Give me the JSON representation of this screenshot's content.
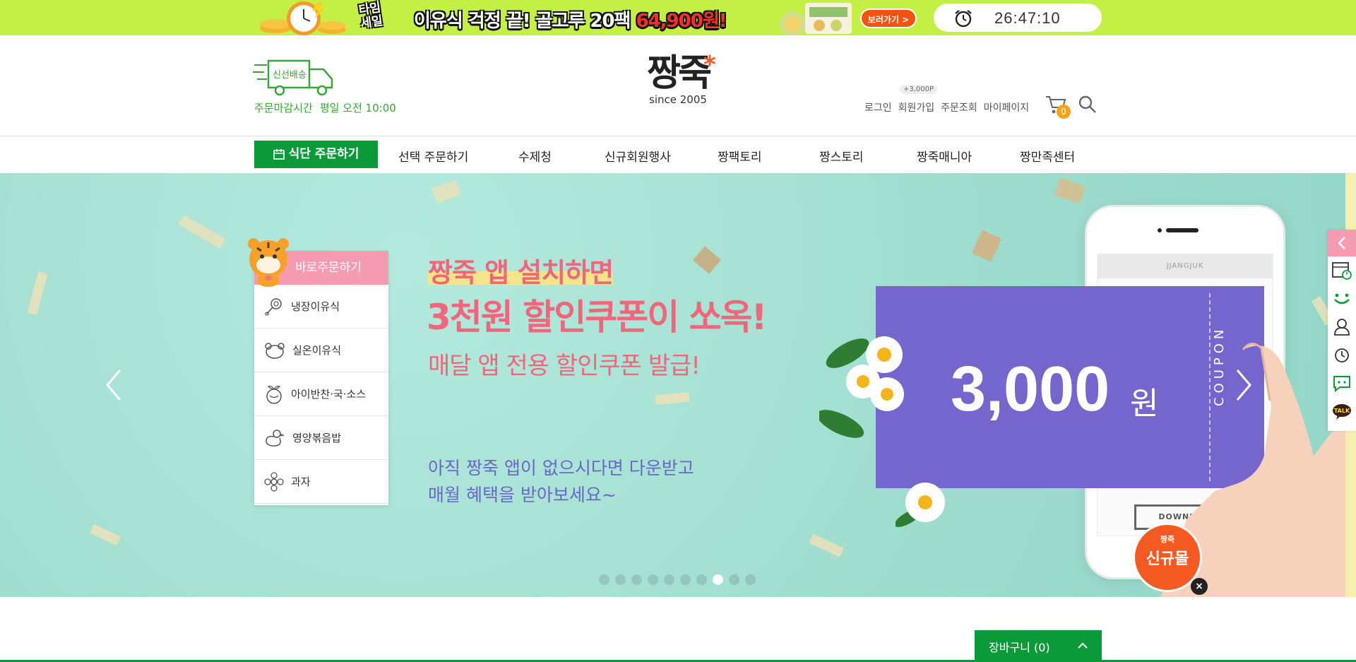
{
  "topbar": {
    "badge_line1": "타임",
    "badge_line2": "세일",
    "promo_text": "이유식 걱정 끝! 골고루 20팩 ",
    "promo_price": "64,900원!",
    "view_button": "보러가기 >",
    "timer": "26:47:10",
    "bg_color": "#c4f045"
  },
  "header": {
    "truck_label": "신선배송",
    "deadline_label": "주문마감시간",
    "deadline_value": "평일 오전 10:00",
    "logo_text": "짱죽",
    "logo_since": "since 2005",
    "point_tag": "+3,000P",
    "util": [
      "로그인",
      "회원가입",
      "주문조회",
      "마이페이지"
    ],
    "cart_count": "0",
    "icons": [
      "truck-icon",
      "cart-icon",
      "search-icon"
    ]
  },
  "nav": {
    "diet_button": "식단 주문하기",
    "items": [
      "선택 주문하기",
      "수제청",
      "신규회원행사",
      "짱팩토리",
      "짱스토리",
      "짱죽매니아",
      "짱만족센터"
    ],
    "accent": "#0b9a3a"
  },
  "quick_menu": {
    "title": "바로주문하기",
    "items": [
      {
        "label": "냉장이유식",
        "icon": "rattle-icon"
      },
      {
        "label": "실온이유식",
        "icon": "bear-icon"
      },
      {
        "label": "아이반찬·국·소스",
        "icon": "apple-icon"
      },
      {
        "label": "영양볶음밥",
        "icon": "duck-icon"
      },
      {
        "label": "과자",
        "icon": "flower-icon"
      }
    ]
  },
  "banner": {
    "headline1": "짱죽 앱 설치하면",
    "headline2": "3천원 할인쿠폰이 쏘옥!",
    "headline3": "매달 앱 전용 할인쿠폰 발급!",
    "sub1": "아직 짱죽 앱이 없으시다면 다운받고",
    "sub2": "매월 혜택을 받아보세요~",
    "coupon_amount": "3,000",
    "coupon_unit": "원",
    "coupon_label": "COUPON",
    "phone_appbar": "JJANGJUK",
    "phone_download": "DOWNLOAD",
    "slide_count": 10,
    "active_slide": 8,
    "text_color": "#f0677c",
    "coupon_color": "#7466cc"
  },
  "new_mall": {
    "small": "짱죽",
    "big": "신규몰",
    "close": "×"
  },
  "right_sidebar": {
    "icons": [
      "collapse-arrow-icon",
      "calendar-clock-icon",
      "smile-icon",
      "person-icon",
      "recent-clock-icon",
      "chat-icon",
      "kakao-talk-icon"
    ],
    "talk_label": "TALK"
  },
  "cart_bar": {
    "label": "장바구니 (0)"
  }
}
